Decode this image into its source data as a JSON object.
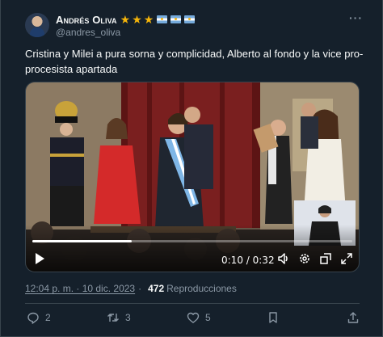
{
  "author": {
    "display_name": "Andrés Oliva",
    "handle": "@andres_oliva",
    "name_emojis": [
      "star",
      "star",
      "star",
      "argentina-flag",
      "argentina-flag",
      "argentina-flag"
    ]
  },
  "tweet": {
    "text": "Cristina y Milei a pura sorna y complicidad, Alberto al fondo y la vice pro-procesista apartada"
  },
  "video": {
    "elapsed": "0:10",
    "duration": "0:32",
    "progress_fraction": 0.31,
    "has_sign_language_inset": true
  },
  "meta": {
    "timestamp": "12:04 p. m. · 10 dic. 2023",
    "separator": "·",
    "views_count": "472",
    "views_label": "Reproducciones"
  },
  "actions": {
    "replies": "2",
    "retweets": "3",
    "likes": "5"
  },
  "colors": {
    "background": "#15202b",
    "text_primary": "#f7f9f9",
    "text_secondary": "#8b98a5",
    "border": "#38444d",
    "star": "#f5b50a",
    "flag_blue": "#75aadb"
  }
}
